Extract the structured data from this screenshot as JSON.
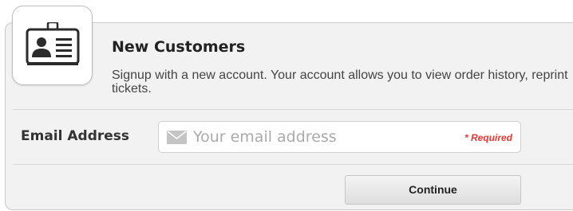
{
  "section": {
    "icon": "id-card-icon",
    "title": "New Customers",
    "description": "Signup with a new account. Your account allows you to view order history, reprint tickets."
  },
  "email": {
    "label": "Email Address",
    "icon": "envelope-icon",
    "placeholder": "Your email address",
    "value": "",
    "required_text": "* Required"
  },
  "actions": {
    "continue_label": "Continue"
  },
  "colors": {
    "required": "#e53935",
    "panel_background": "#f2f2f2",
    "icon_dark": "#2b2b2b"
  }
}
